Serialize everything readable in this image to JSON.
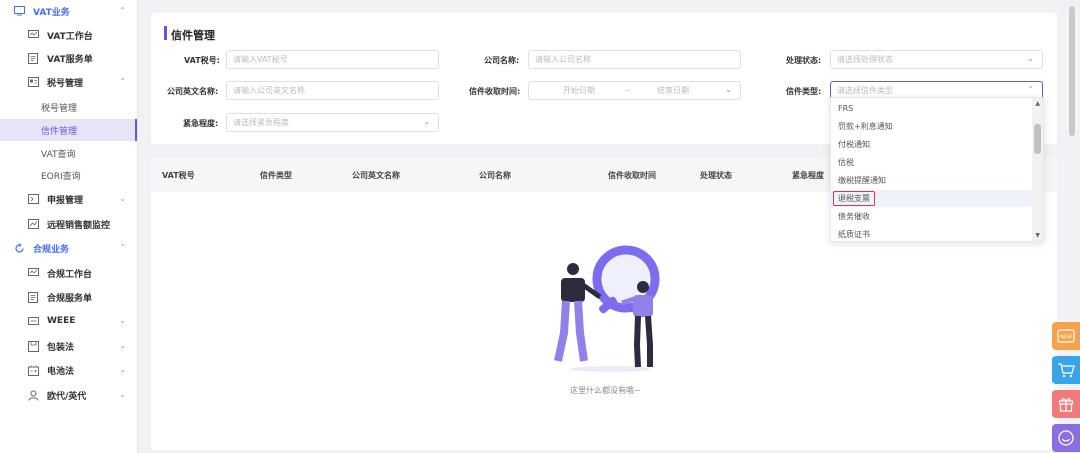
{
  "sidebar": {
    "vat_business": "VAT业务",
    "vat_workbench": "VAT工作台",
    "vat_service_order": "VAT服务单",
    "tax_number_mgmt": "税号管理",
    "tax_number_mgmt_sub": "税号管理",
    "letter_mgmt": "信件管理",
    "vat_query": "VAT查询",
    "eori_query": "EORI查询",
    "declaration_mgmt": "申报管理",
    "remote_sales_monitor": "远程销售额监控",
    "compliance_business": "合规业务",
    "compliance_workbench": "合规工作台",
    "compliance_service_order": "合规服务单",
    "weee": "WEEE",
    "packaging_law": "包装法",
    "battery_law": "电池法",
    "eu_uk_rep": "欧代/英代"
  },
  "page_title": "信件管理",
  "filters": {
    "vat_no_label": "VAT税号:",
    "vat_no_placeholder": "请输入VAT税号",
    "company_name_label": "公司名称:",
    "company_name_placeholder": "请输入公司名称",
    "status_label": "处理状态:",
    "status_placeholder": "请选择处理状态",
    "company_en_label": "公司英文名称:",
    "company_en_placeholder": "请输入公司英文名称",
    "received_time_label": "信件收取时间:",
    "start_date_placeholder": "开始日期",
    "date_sep": "~",
    "end_date_placeholder": "结束日期",
    "letter_type_label": "信件类型:",
    "letter_type_placeholder": "请选择信件类型",
    "urgency_label": "紧急程度:",
    "urgency_placeholder": "请选择紧急程度"
  },
  "table": {
    "headers": [
      "VAT税号",
      "信件类型",
      "公司英文名称",
      "公司名称",
      "信件收取时间",
      "处理状态",
      "紧急程度"
    ],
    "empty_text": "这里什么都没有哦~"
  },
  "dropdown": {
    "options": [
      "FRS",
      "罚款+利息通知",
      "付税通知",
      "估税",
      "缴税提醒通知",
      "退税支票",
      "债务催收",
      "纸质证书"
    ],
    "highlighted_index": 5
  },
  "colors": {
    "accent": "#6a55d8",
    "brand_blue": "#4a6cf7",
    "highlight_red": "#e53935"
  }
}
